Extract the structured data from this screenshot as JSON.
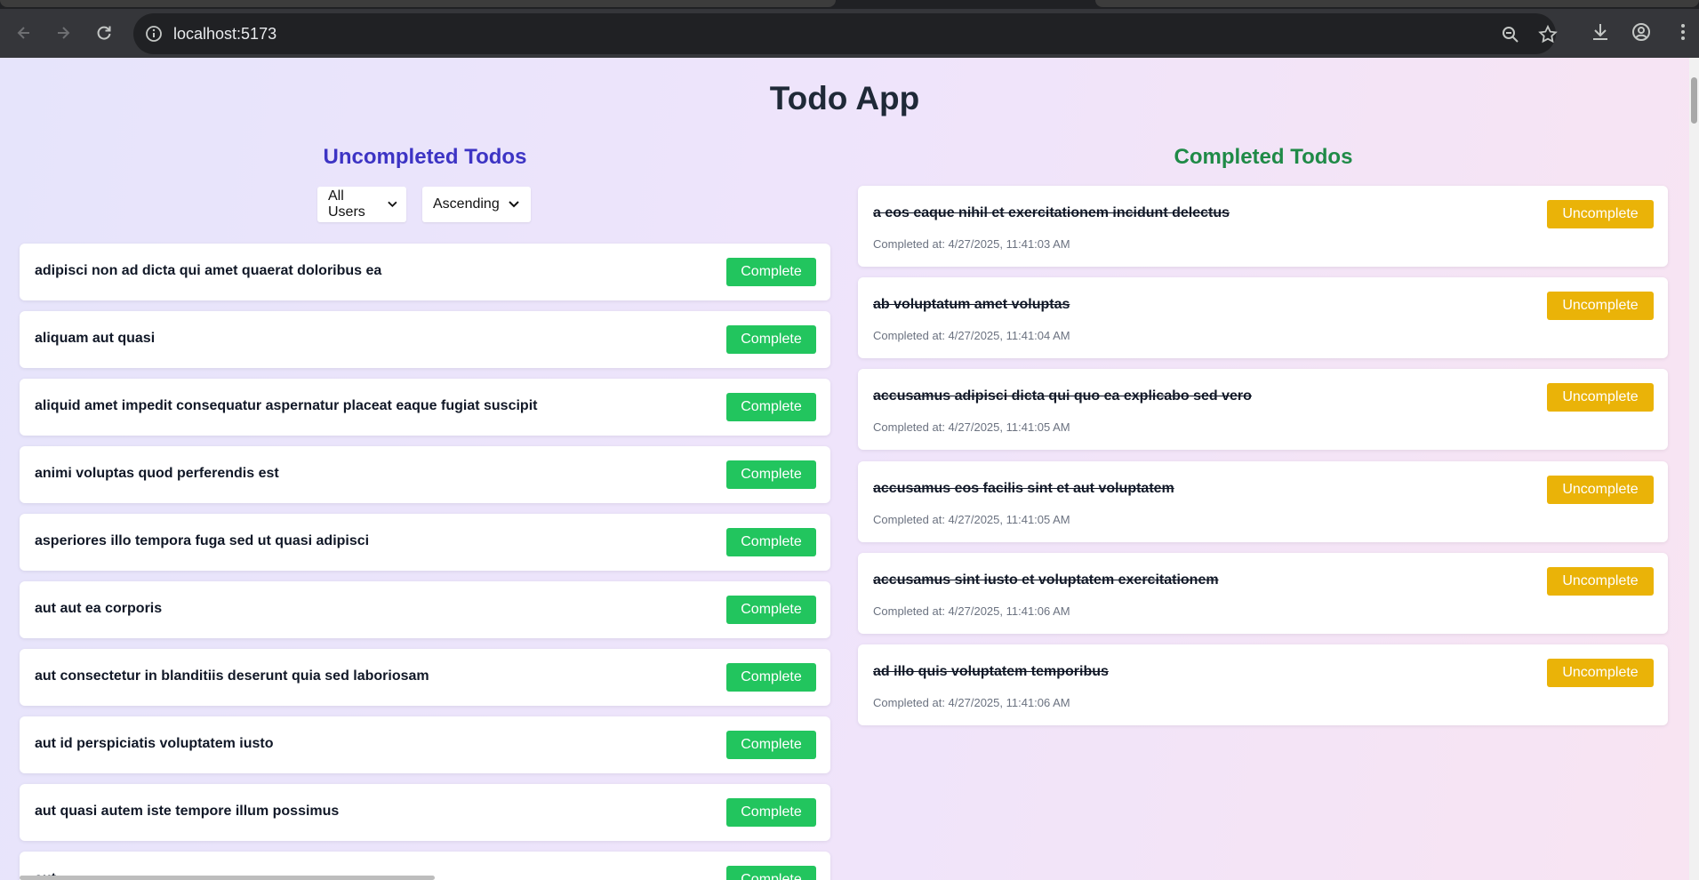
{
  "browser": {
    "url": "localhost:5173"
  },
  "page": {
    "title": "Todo App"
  },
  "uncompleted": {
    "heading": "Uncompleted Todos",
    "user_filter": "All Users",
    "sort_order": "Ascending",
    "button_label": "Complete",
    "items": [
      "adipisci non ad dicta qui amet quaerat doloribus ea",
      "aliquam aut quasi",
      "aliquid amet impedit consequatur aspernatur placeat eaque fugiat suscipit",
      "animi voluptas quod perferendis est",
      "asperiores illo tempora fuga sed ut quasi adipisci",
      "aut aut ea corporis",
      "aut consectetur in blanditiis deserunt quia sed laboriosam",
      "aut id perspiciatis voluptatem iusto",
      "aut quasi autem iste tempore illum possimus",
      "aut ..."
    ]
  },
  "completed": {
    "heading": "Completed Todos",
    "button_label": "Uncomplete",
    "items": [
      {
        "title": "a eos eaque nihil et exercitationem incidunt delectus",
        "completed_at": "Completed at: 4/27/2025, 11:41:03 AM"
      },
      {
        "title": "ab voluptatum amet voluptas",
        "completed_at": "Completed at: 4/27/2025, 11:41:04 AM"
      },
      {
        "title": "accusamus adipisci dicta qui quo ea explicabo sed vero",
        "completed_at": "Completed at: 4/27/2025, 11:41:05 AM"
      },
      {
        "title": "accusamus eos facilis sint et aut voluptatem",
        "completed_at": "Completed at: 4/27/2025, 11:41:05 AM"
      },
      {
        "title": "accusamus sint iusto et voluptatem exercitationem",
        "completed_at": "Completed at: 4/27/2025, 11:41:06 AM"
      },
      {
        "title": "ad illo quis voluptatem temporibus",
        "completed_at": "Completed at: 4/27/2025, 11:41:06 AM"
      }
    ]
  },
  "colors": {
    "complete_button": "#22c55e",
    "uncomplete_button": "#eab308",
    "uncompleted_heading": "#3d34c4",
    "completed_heading": "#1f8a47"
  }
}
